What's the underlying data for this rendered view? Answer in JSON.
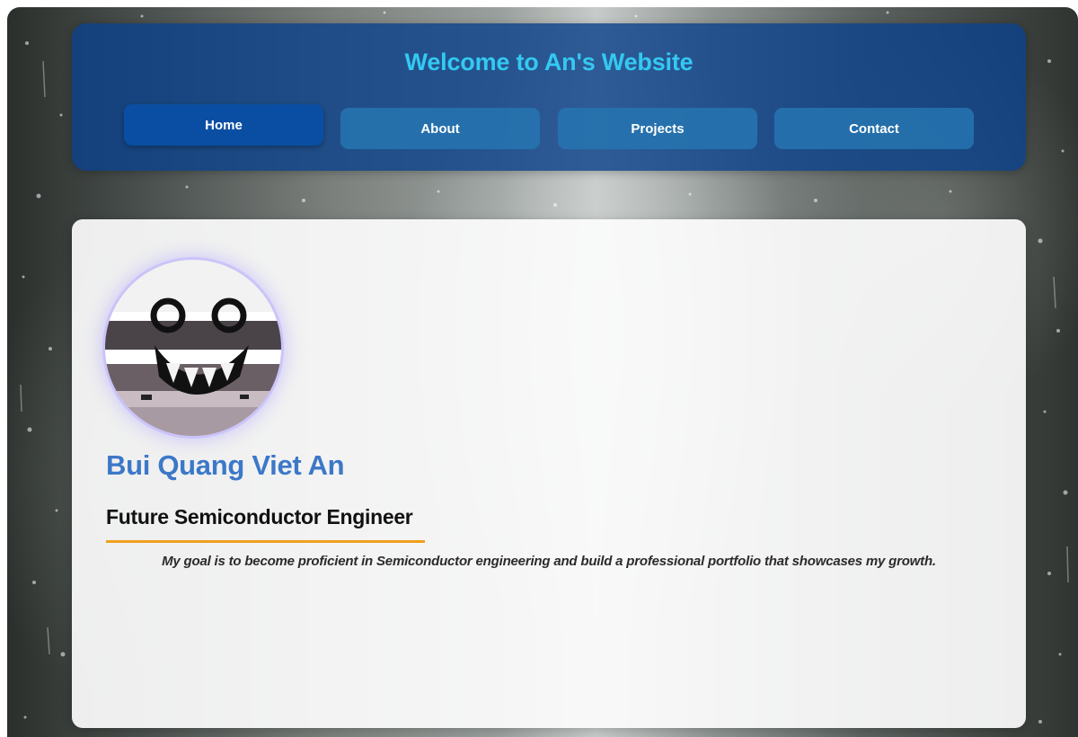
{
  "header": {
    "title": "Welcome to An's Website"
  },
  "nav": {
    "items": [
      {
        "label": "Home",
        "active": true
      },
      {
        "label": "About",
        "active": false
      },
      {
        "label": "Projects",
        "active": false
      },
      {
        "label": "Contact",
        "active": false
      }
    ]
  },
  "profile": {
    "name": "Bui Quang Viet An",
    "role": "Future Semiconductor Engineer",
    "goal": "My goal is to become proficient in Semiconductor engineering and build a professional portfolio that showcases my growth."
  },
  "colors": {
    "header_bg": "#0c428a",
    "title": "#33c9f2",
    "nav_button": "#2676b2",
    "nav_active": "#0a4ea3",
    "name": "#3c78c8",
    "underline": "#f0a020"
  }
}
